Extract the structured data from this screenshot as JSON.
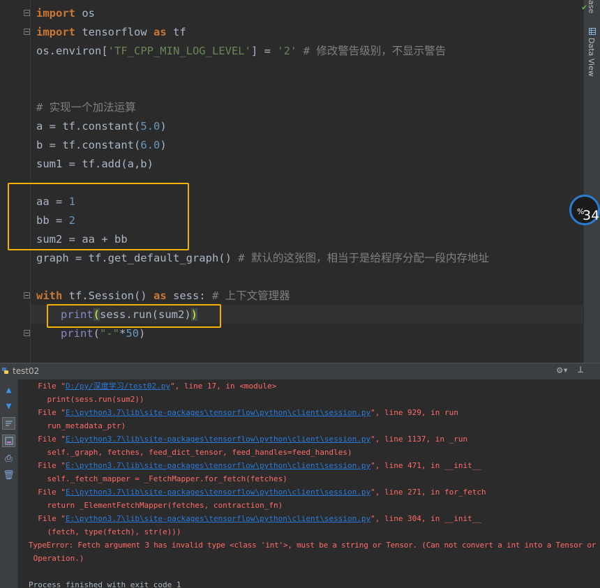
{
  "editor": {
    "lines": [
      {
        "kw": "import",
        "rest": " os"
      },
      {
        "kw": "import",
        "mid": " tensorflow ",
        "kw2": "as",
        "rest": " tf"
      },
      {
        "a": "os.environ[",
        "s": "'TF_CPP_MIN_LOG_LEVEL'",
        "b": "] = ",
        "s2": "'2'",
        "c": " # 修改警告级别，不显示警告"
      },
      {
        "c": "# 实现一个加法运算"
      },
      {
        "a": "a = tf.constant(",
        "n": "5.0",
        "b": ")"
      },
      {
        "a": "b = tf.constant(",
        "n": "6.0",
        "b": ")"
      },
      {
        "a": "sum1 = tf.add(a,b)"
      },
      {
        "a": "aa = ",
        "n": "1"
      },
      {
        "a": "bb = ",
        "n": "2"
      },
      {
        "a": "sum2 = aa + bb"
      },
      {
        "a": "graph = tf.get_default_graph() ",
        "c": "# 默认的这张图，相当于是给程序分配一段内存地址"
      },
      {
        "kw": "with",
        "mid": " tf.Session() ",
        "kw2": "as",
        "rest": " sess: ",
        "c": "# 上下文管理器"
      },
      {
        "f": "print",
        "o": "(",
        "a": "sess.run(sum2)",
        "cl": ")"
      },
      {
        "f": "print",
        "a": "(",
        "s": "\"-\"",
        "b": "*",
        "n": "50",
        "cl": ")"
      }
    ]
  },
  "sidebar_right": {
    "top_label": "ase",
    "data_view_label": "Data View"
  },
  "badge": {
    "value": "34",
    "unit": "%"
  },
  "run_panel": {
    "title": "test02",
    "output": [
      {
        "p": "  File \"",
        "l": "D:/py/深度学习/test02.py",
        "q": "\", line 17, in <module>"
      },
      {
        "t": "    print(sess.run(sum2))"
      },
      {
        "p": "  File \"",
        "l": "E:\\python3.7\\lib\\site-packages\\tensorflow\\python\\client\\session.py",
        "q": "\", line 929, in run"
      },
      {
        "t": "    run_metadata_ptr)"
      },
      {
        "p": "  File \"",
        "l": "E:\\python3.7\\lib\\site-packages\\tensorflow\\python\\client\\session.py",
        "q": "\", line 1137, in _run"
      },
      {
        "t": "    self._graph, fetches, feed_dict_tensor, feed_handles=feed_handles)"
      },
      {
        "p": "  File \"",
        "l": "E:\\python3.7\\lib\\site-packages\\tensorflow\\python\\client\\session.py",
        "q": "\", line 471, in __init__"
      },
      {
        "t": "    self._fetch_mapper = _FetchMapper.for_fetch(fetches)"
      },
      {
        "p": "  File \"",
        "l": "E:\\python3.7\\lib\\site-packages\\tensorflow\\python\\client\\session.py",
        "q": "\", line 271, in for_fetch"
      },
      {
        "t": "    return _ElementFetchMapper(fetches, contraction_fn)"
      },
      {
        "p": "  File \"",
        "l": "E:\\python3.7\\lib\\site-packages\\tensorflow\\python\\client\\session.py",
        "q": "\", line 304, in __init__"
      },
      {
        "t": "    (fetch, type(fetch), str(e)))"
      },
      {
        "t": "TypeError: Fetch argument 3 has invalid type <class 'int'>, must be a string or Tensor. (Can not convert a int into a Tensor or"
      },
      {
        "t": " Operation.)"
      },
      {
        "t": ""
      },
      {
        "t": "Process finished with exit code 1"
      }
    ]
  }
}
